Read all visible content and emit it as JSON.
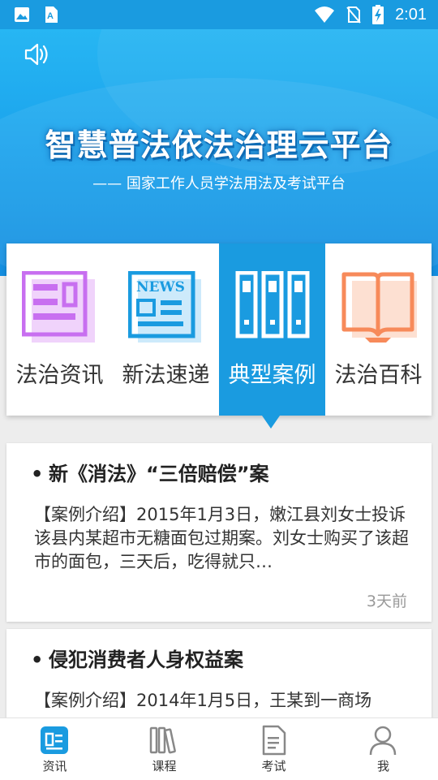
{
  "status_bar": {
    "time": "2:01",
    "icons": [
      "image-icon",
      "text-a-icon",
      "wifi-icon",
      "no-sim-icon",
      "battery-charging-icon"
    ]
  },
  "banner": {
    "speaker_icon": "speaker-icon",
    "title": "智慧普法依法治理云平台",
    "subtitle": "—— 国家工作人员学法用法及考试平台"
  },
  "categories": [
    {
      "label": "法治资讯",
      "icon": "document-icon",
      "color": "#c86ff0",
      "active": false
    },
    {
      "label": "新法速递",
      "icon": "news-icon",
      "color": "#1a9be0",
      "active": false
    },
    {
      "label": "典型案例",
      "icon": "binders-icon",
      "color": "#ffffff",
      "active": true
    },
    {
      "label": "法治百科",
      "icon": "book-icon",
      "color": "#f78a5a",
      "active": false
    }
  ],
  "articles": [
    {
      "title": "新《消法》“三倍赔偿”案",
      "summary": "【案例介绍】2015年1月3日，嫩江县刘女士投诉该县内某超市无糖面包过期案。刘女士购买了该超市的面包，三天后，吃得就只…",
      "time": "3天前"
    },
    {
      "title": "侵犯消费者人身权益案",
      "summary": "【案例介绍】2014年1月5日，王某到一商场"
    }
  ],
  "bottom_nav": [
    {
      "label": "资讯",
      "icon": "news-tab-icon",
      "active": true
    },
    {
      "label": "课程",
      "icon": "books-tab-icon",
      "active": false
    },
    {
      "label": "考试",
      "icon": "exam-tab-icon",
      "active": false
    },
    {
      "label": "我",
      "icon": "person-tab-icon",
      "active": false
    }
  ],
  "colors": {
    "accent": "#1a9be0",
    "status_bar": "#1a9be0",
    "time_gray": "#999999"
  }
}
